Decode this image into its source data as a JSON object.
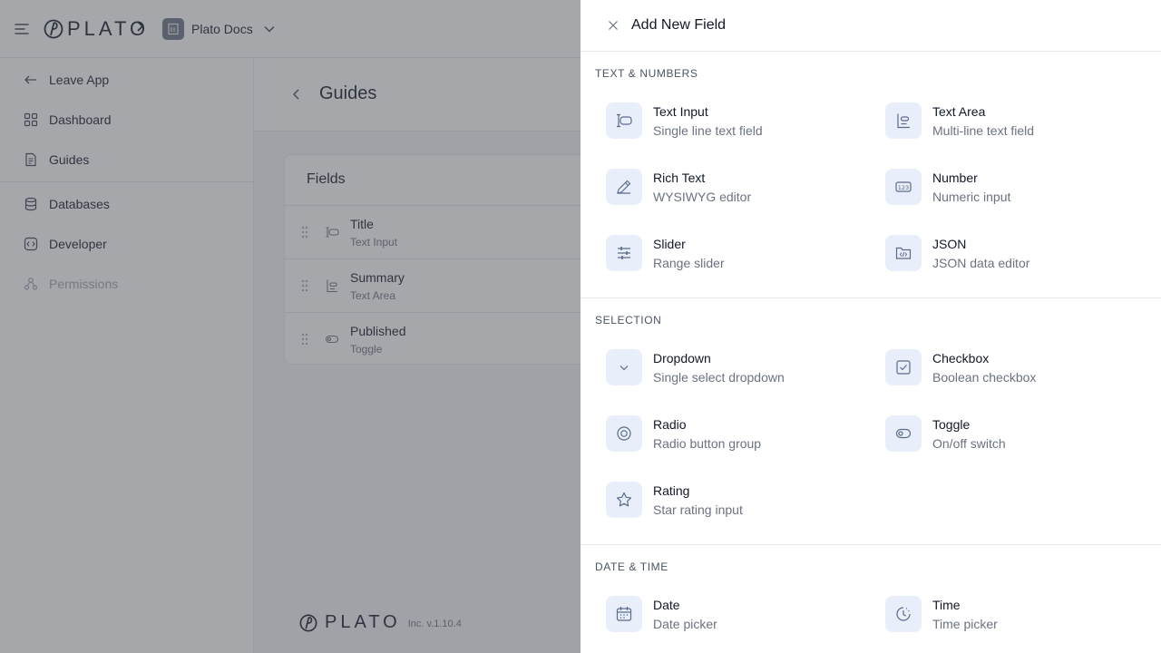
{
  "topbar": {
    "logo_text": "PLATO",
    "project_name": "Plato Docs"
  },
  "sidebar": {
    "items": [
      {
        "label": "Leave App",
        "icon": "arrow-left-icon"
      },
      {
        "label": "Dashboard",
        "icon": "dashboard-icon"
      },
      {
        "label": "Guides",
        "icon": "document-icon"
      },
      {
        "label": "Databases",
        "icon": "database-icon"
      },
      {
        "label": "Developer",
        "icon": "code-icon"
      },
      {
        "label": "Permissions",
        "icon": "users-icon",
        "disabled": true
      }
    ],
    "footer": {
      "logo_text": "PLATO",
      "version": "Inc. v.1.10.4"
    }
  },
  "page": {
    "title": "Guides",
    "fields_card": {
      "heading": "Fields",
      "fields": [
        {
          "name": "Title",
          "type": "Text Input"
        },
        {
          "name": "Summary",
          "type": "Text Area"
        },
        {
          "name": "Published",
          "type": "Toggle"
        }
      ]
    }
  },
  "drawer": {
    "title": "Add New Field",
    "sections": [
      {
        "title": "TEXT & NUMBERS",
        "options": [
          {
            "label": "Text Input",
            "description": "Single line text field",
            "icon": "text-input-icon"
          },
          {
            "label": "Text Area",
            "description": "Multi-line text field",
            "icon": "text-area-icon"
          },
          {
            "label": "Rich Text",
            "description": "WYSIWYG editor",
            "icon": "pencil-icon"
          },
          {
            "label": "Number",
            "description": "Numeric input",
            "icon": "number-icon"
          },
          {
            "label": "Slider",
            "description": "Range slider",
            "icon": "sliders-icon"
          },
          {
            "label": "JSON",
            "description": "JSON data editor",
            "icon": "json-icon"
          }
        ]
      },
      {
        "title": "SELECTION",
        "options": [
          {
            "label": "Dropdown",
            "description": "Single select dropdown",
            "icon": "chevron-down-icon"
          },
          {
            "label": "Checkbox",
            "description": "Boolean checkbox",
            "icon": "checkbox-icon"
          },
          {
            "label": "Radio",
            "description": "Radio button group",
            "icon": "radio-icon"
          },
          {
            "label": "Toggle",
            "description": "On/off switch",
            "icon": "toggle-icon"
          },
          {
            "label": "Rating",
            "description": "Star rating input",
            "icon": "star-icon"
          }
        ]
      },
      {
        "title": "DATE & TIME",
        "options": [
          {
            "label": "Date",
            "description": "Date picker",
            "icon": "calendar-icon"
          },
          {
            "label": "Time",
            "description": "Time picker",
            "icon": "clock-icon"
          }
        ]
      }
    ]
  }
}
